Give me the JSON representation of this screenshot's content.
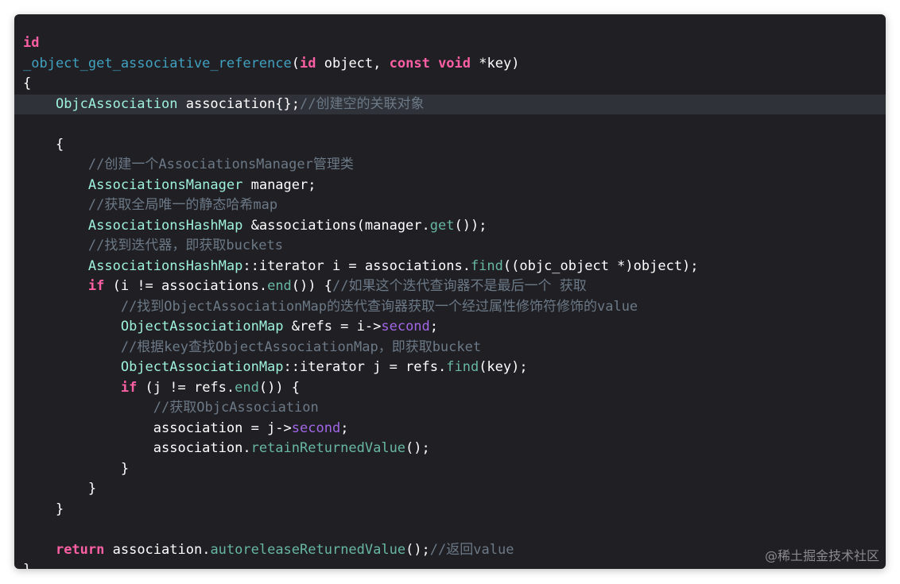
{
  "editor": {
    "lines": [
      [
        {
          "t": "id",
          "c": "kw"
        }
      ],
      [
        {
          "t": "_object_get_associative_reference",
          "c": "fn"
        },
        {
          "t": "(",
          "c": ""
        },
        {
          "t": "id",
          "c": "kw"
        },
        {
          "t": " object, ",
          "c": ""
        },
        {
          "t": "const",
          "c": "kw"
        },
        {
          "t": " ",
          "c": ""
        },
        {
          "t": "void",
          "c": "kw"
        },
        {
          "t": " *key)",
          "c": ""
        }
      ],
      [
        {
          "t": "{",
          "c": ""
        }
      ],
      [
        {
          "t": "    ",
          "c": ""
        },
        {
          "t": "ObjcAssociation",
          "c": "ty"
        },
        {
          "t": " association{};",
          "c": ""
        },
        {
          "t": "//创建空的关联对象",
          "c": "cm"
        }
      ],
      [],
      [
        {
          "t": "    {",
          "c": ""
        }
      ],
      [
        {
          "t": "        ",
          "c": ""
        },
        {
          "t": "//创建一个AssociationsManager管理类",
          "c": "cm"
        }
      ],
      [
        {
          "t": "        ",
          "c": ""
        },
        {
          "t": "AssociationsManager",
          "c": "ty"
        },
        {
          "t": " manager;",
          "c": ""
        }
      ],
      [
        {
          "t": "        ",
          "c": ""
        },
        {
          "t": "//获取全局唯一的静态哈希map",
          "c": "cm"
        }
      ],
      [
        {
          "t": "        ",
          "c": ""
        },
        {
          "t": "AssociationsHashMap",
          "c": "ty"
        },
        {
          "t": " &associations(manager.",
          "c": ""
        },
        {
          "t": "get",
          "c": "md"
        },
        {
          "t": "());",
          "c": ""
        }
      ],
      [
        {
          "t": "        ",
          "c": ""
        },
        {
          "t": "//找到迭代器，即获取buckets",
          "c": "cm"
        }
      ],
      [
        {
          "t": "        ",
          "c": ""
        },
        {
          "t": "AssociationsHashMap",
          "c": "ty"
        },
        {
          "t": "::iterator i = associations.",
          "c": ""
        },
        {
          "t": "find",
          "c": "md"
        },
        {
          "t": "((objc_object *)object);",
          "c": ""
        }
      ],
      [
        {
          "t": "        ",
          "c": ""
        },
        {
          "t": "if",
          "c": "kw"
        },
        {
          "t": " (i != associations.",
          "c": ""
        },
        {
          "t": "end",
          "c": "md"
        },
        {
          "t": "()) {",
          "c": ""
        },
        {
          "t": "//如果这个迭代查询器不是最后一个 获取",
          "c": "cm"
        }
      ],
      [
        {
          "t": "            ",
          "c": ""
        },
        {
          "t": "//找到ObjectAssociationMap的迭代查询器获取一个经过属性修饰符修饰的value",
          "c": "cm"
        }
      ],
      [
        {
          "t": "            ",
          "c": ""
        },
        {
          "t": "ObjectAssociationMap",
          "c": "ty"
        },
        {
          "t": " &refs = i->",
          "c": ""
        },
        {
          "t": "second",
          "c": "pr"
        },
        {
          "t": ";",
          "c": ""
        }
      ],
      [
        {
          "t": "            ",
          "c": ""
        },
        {
          "t": "//根据key查找ObjectAssociationMap，即获取bucket",
          "c": "cm"
        }
      ],
      [
        {
          "t": "            ",
          "c": ""
        },
        {
          "t": "ObjectAssociationMap",
          "c": "ty"
        },
        {
          "t": "::iterator j = refs.",
          "c": ""
        },
        {
          "t": "find",
          "c": "md"
        },
        {
          "t": "(key);",
          "c": ""
        }
      ],
      [
        {
          "t": "            ",
          "c": ""
        },
        {
          "t": "if",
          "c": "kw"
        },
        {
          "t": " (j != refs.",
          "c": ""
        },
        {
          "t": "end",
          "c": "md"
        },
        {
          "t": "()) {",
          "c": ""
        }
      ],
      [
        {
          "t": "                ",
          "c": ""
        },
        {
          "t": "//获取ObjcAssociation",
          "c": "cm"
        }
      ],
      [
        {
          "t": "                association = j->",
          "c": ""
        },
        {
          "t": "second",
          "c": "pr"
        },
        {
          "t": ";",
          "c": ""
        }
      ],
      [
        {
          "t": "                association.",
          "c": ""
        },
        {
          "t": "retainReturnedValue",
          "c": "md"
        },
        {
          "t": "();",
          "c": ""
        }
      ],
      [
        {
          "t": "            }",
          "c": ""
        }
      ],
      [
        {
          "t": "        }",
          "c": ""
        }
      ],
      [
        {
          "t": "    }",
          "c": ""
        }
      ],
      [],
      [
        {
          "t": "    ",
          "c": ""
        },
        {
          "t": "return",
          "c": "kw"
        },
        {
          "t": " association.",
          "c": ""
        },
        {
          "t": "autoreleaseReturnedValue",
          "c": "md"
        },
        {
          "t": "();",
          "c": ""
        },
        {
          "t": "//返回value",
          "c": "cm"
        }
      ],
      [
        {
          "t": "}",
          "c": ""
        }
      ]
    ],
    "highlighted_line": 3
  },
  "watermark": "@稀土掘金技术社区",
  "colors": {
    "background": "#1f1f24",
    "keyword": "#fc5fa3",
    "function": "#41a1c0",
    "type": "#9ef1dd",
    "method": "#67b7a4",
    "property": "#a167e6",
    "comment": "#6c7986",
    "plain": "#ffffff"
  }
}
